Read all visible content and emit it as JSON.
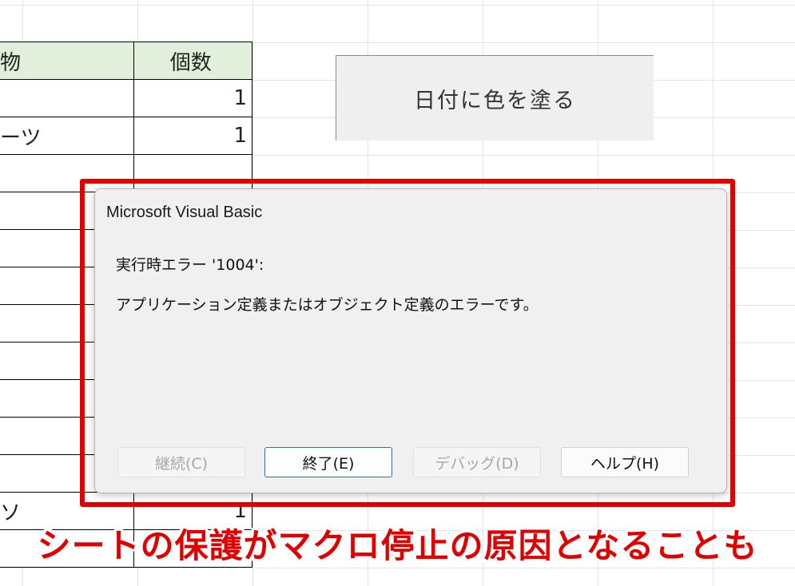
{
  "sheet": {
    "header": {
      "col1": "物",
      "col2": "個数"
    },
    "rows": [
      {
        "col1": "",
        "col2": "1"
      },
      {
        "col1": "ーツ",
        "col2": "1"
      },
      {
        "col1": "",
        "col2": ""
      },
      {
        "col1": "",
        "col2": ""
      },
      {
        "col1": "",
        "col2": ""
      },
      {
        "col1": "",
        "col2": ""
      },
      {
        "col1": "",
        "col2": ""
      },
      {
        "col1": "",
        "col2": ""
      },
      {
        "col1": "",
        "col2": ""
      },
      {
        "col1": "",
        "col2": ""
      },
      {
        "col1": "",
        "col2": ""
      },
      {
        "col1": "ソ",
        "col2": "1"
      },
      {
        "col1": "",
        "col2": ""
      }
    ],
    "header_fill": "#e2efda"
  },
  "shape_button": {
    "label": "日付に色を塗る"
  },
  "dialog": {
    "title": "Microsoft Visual Basic",
    "error_line": "実行時エラー '1004':",
    "message": "アプリケーション定義またはオブジェクト定義のエラーです。",
    "buttons": {
      "continue": "継続(C)",
      "end": "終了(E)",
      "debug": "デバッグ(D)",
      "help": "ヘルプ(H)"
    }
  },
  "annotation": {
    "caption": "シートの保護がマクロ停止の原因となることも",
    "color": "#e00000"
  }
}
